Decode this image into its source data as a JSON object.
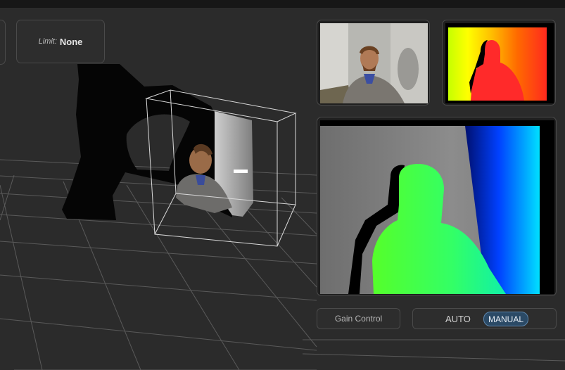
{
  "toolbar": {
    "limit_label": "Limit:",
    "limit_value": "None"
  },
  "previews": {
    "rgb_camera": "rgb-camera-preview",
    "depth_colormap": "depth-colormap-preview",
    "infrared_depth": "depth-large-preview"
  },
  "controls": {
    "gain_label": "Gain Control",
    "auto_label": "AUTO",
    "manual_label": "MANUAL",
    "selected_mode": "MANUAL"
  },
  "colors": {
    "background": "#2b2b2b",
    "panel_border": "#4a4a4a",
    "toggle_active_bg": "#2b4a66",
    "toggle_active_border": "#5d86ad"
  }
}
